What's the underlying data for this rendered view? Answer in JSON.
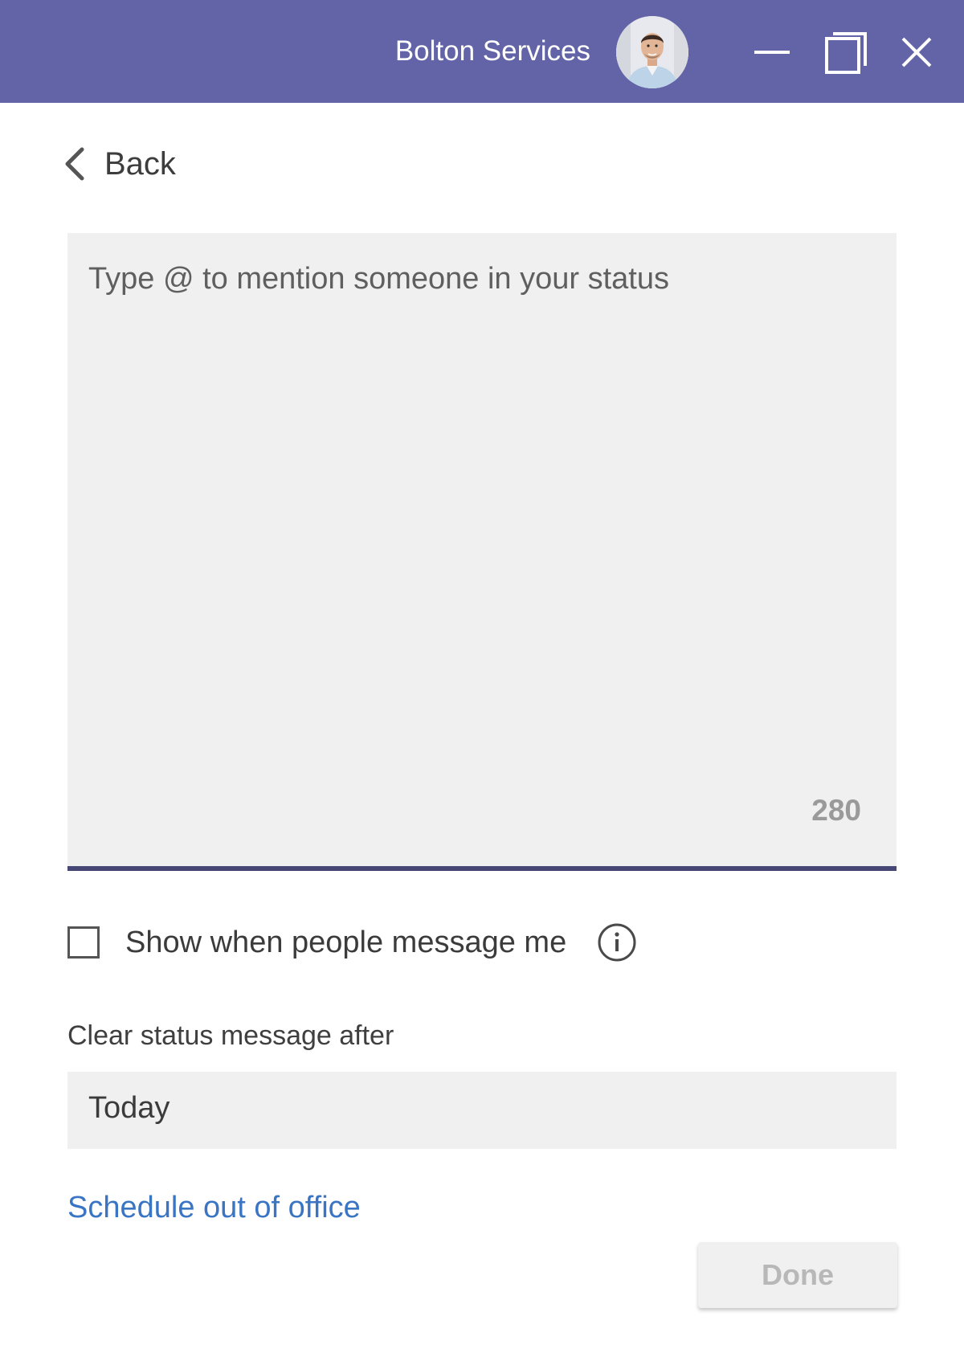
{
  "titlebar": {
    "org_name": "Bolton Services",
    "avatar_icon": "user-avatar-photo",
    "minimize_icon": "minimize-icon",
    "maximize_icon": "maximize-icon",
    "close_icon": "close-icon",
    "background_color": "#6264a7"
  },
  "back": {
    "label": "Back",
    "icon": "chevron-left-icon"
  },
  "status_input": {
    "placeholder": "Type @ to mention someone in your status",
    "value": "",
    "char_remaining": "280",
    "underline_color": "#464775"
  },
  "show_when_message": {
    "label": "Show when people message me",
    "checked": false,
    "info_icon": "info-icon"
  },
  "clear_after": {
    "label": "Clear status message after",
    "selected": "Today"
  },
  "schedule_link": {
    "label": "Schedule out of office",
    "color": "#3a75c4"
  },
  "done_button": {
    "label": "Done",
    "disabled": true
  }
}
